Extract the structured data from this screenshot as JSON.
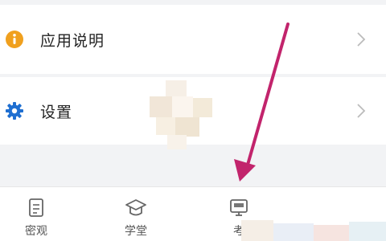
{
  "menu": {
    "items": [
      {
        "label": "应用说明",
        "icon": "info-icon",
        "icon_color": "#f0a01e"
      },
      {
        "label": "设置",
        "icon": "gear-icon",
        "icon_color": "#1f6fd1"
      }
    ]
  },
  "tabbar": {
    "tabs": [
      {
        "label": "密观",
        "icon": "document-icon"
      },
      {
        "label": "学堂",
        "icon": "graduation-cap-icon"
      },
      {
        "label": "考",
        "icon": "monitor-icon"
      }
    ]
  },
  "annotation": {
    "arrow_color": "#c2246c"
  },
  "colors": {
    "background": "#f2f3f5",
    "row_background": "#ffffff",
    "text": "#222222",
    "chevron": "#bbbbbb",
    "tab_text": "#555555"
  }
}
